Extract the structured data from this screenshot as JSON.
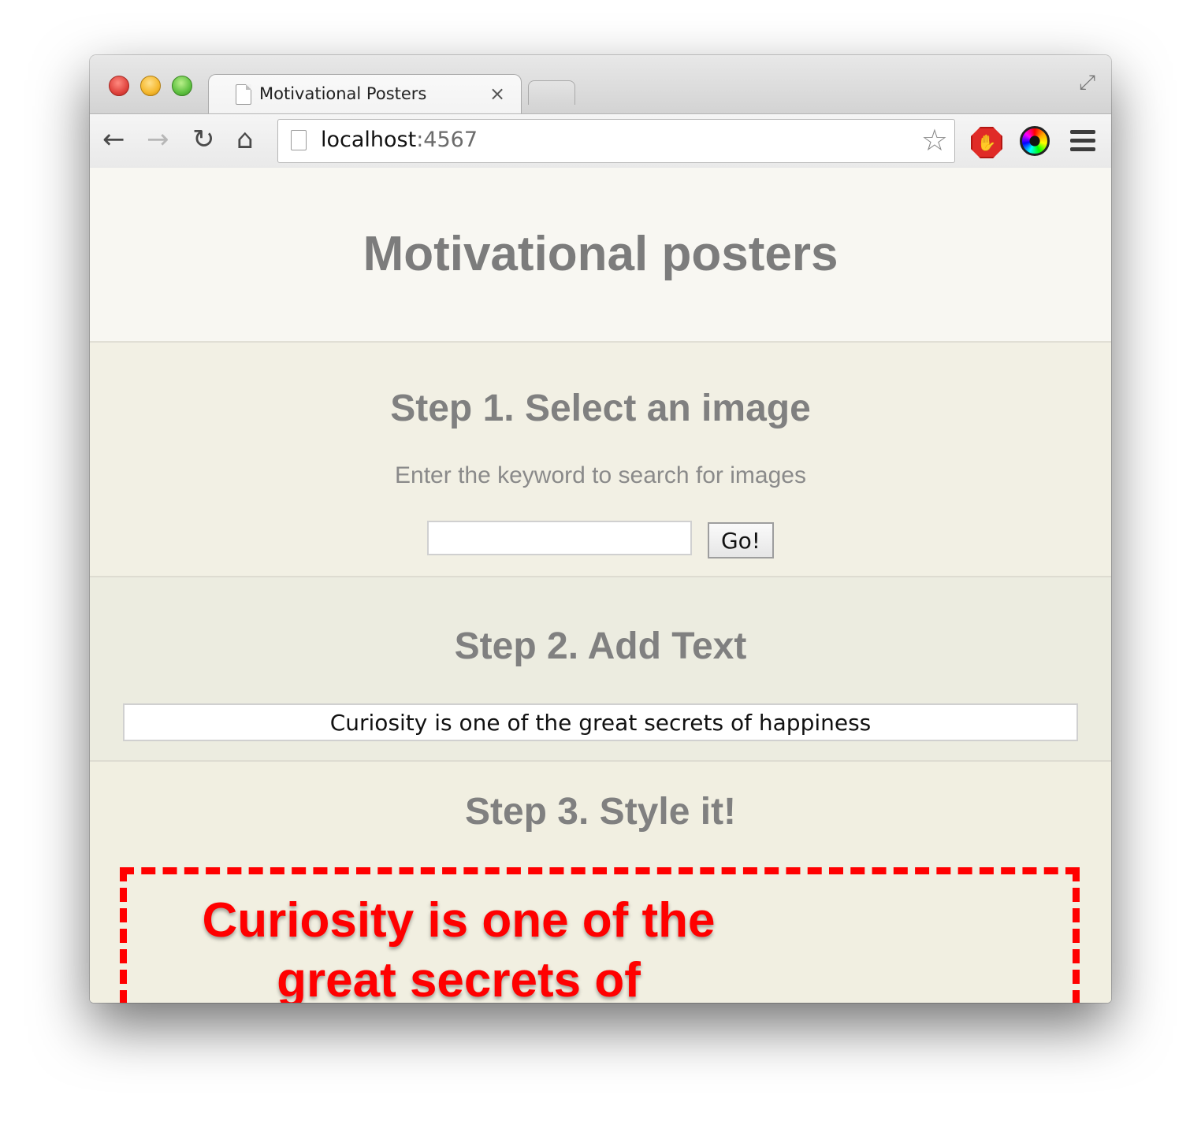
{
  "browser": {
    "tab_title": "Motivational Posters",
    "tab_close": "×",
    "url_host": "localhost",
    "url_port": ":4567",
    "icons": {
      "back": "←",
      "forward": "→",
      "reload": "↻",
      "home": "⌂",
      "star": "☆",
      "fullscreen": "⤢",
      "stop_ext": "✋"
    }
  },
  "page": {
    "title": "Motivational posters",
    "step1": {
      "heading": "Step 1. Select an image",
      "hint": "Enter the keyword to search for images",
      "search_value": "",
      "go_label": "Go!"
    },
    "step2": {
      "heading": "Step 2. Add Text",
      "text_value": "Curiosity is one of the great secrets of happiness"
    },
    "step3": {
      "heading": "Step 3. Style it!",
      "poster_text": "Curiosity is one of the great secrets of"
    }
  },
  "colors": {
    "poster_text": "#ff0000",
    "poster_border": "#ff0000",
    "heading_gray": "#7c7c7c"
  }
}
